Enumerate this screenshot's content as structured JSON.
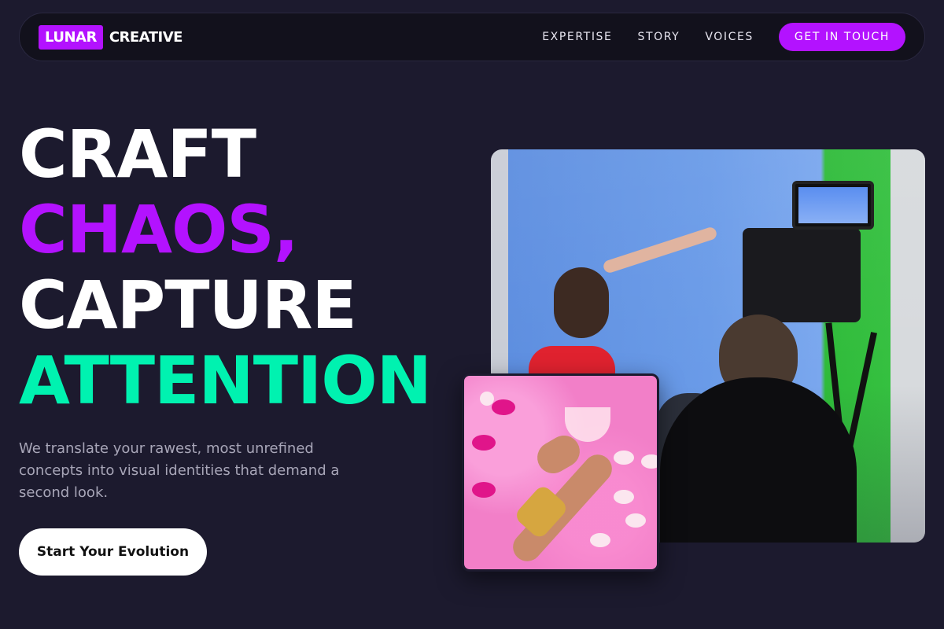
{
  "brand": {
    "badge": "LUNAR",
    "name": "CREATIVE"
  },
  "nav": {
    "links": [
      "EXPERTISE",
      "STORY",
      "VOICES"
    ],
    "cta": "GET IN TOUCH"
  },
  "hero": {
    "lines": [
      "CRAFT",
      "CHAOS,",
      "CAPTURE",
      "ATTENTION"
    ],
    "subtitle": "We translate your rawest, most unrefined concepts into visual identities that demand a second look.",
    "button": "Start Your Evolution"
  },
  "images": {
    "main": "film-set-photo",
    "secondary": "pink-fur-jewelry-photo"
  },
  "colors": {
    "background": "#1c1a2e",
    "accent_purple": "#b312ff",
    "accent_green": "#00f2b0"
  }
}
